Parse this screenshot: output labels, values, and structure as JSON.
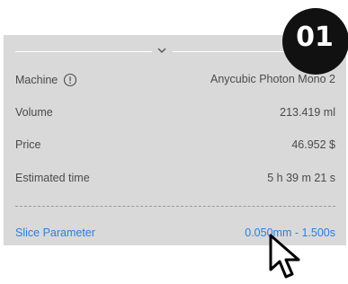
{
  "step_badge": "01",
  "rows": [
    {
      "label": "Machine",
      "value": "Anycubic Photon Mono 2"
    },
    {
      "label": "Volume",
      "value": "213.419 ml"
    },
    {
      "label": "Price",
      "value": "46.952 $"
    },
    {
      "label": "Estimated time",
      "value": "5 h 39 m 21 s"
    }
  ],
  "slice_parameter": {
    "label": "Slice Parameter",
    "value": "0.050mm - 1.500s"
  },
  "icons": {
    "collapse": "chevron-down-icon",
    "info": "info-icon",
    "cursor": "arrow-cursor-icon"
  },
  "colors": {
    "panel_bg": "#d9d9d9",
    "link_blue": "#2e7fd6",
    "badge_bg": "#111111"
  }
}
